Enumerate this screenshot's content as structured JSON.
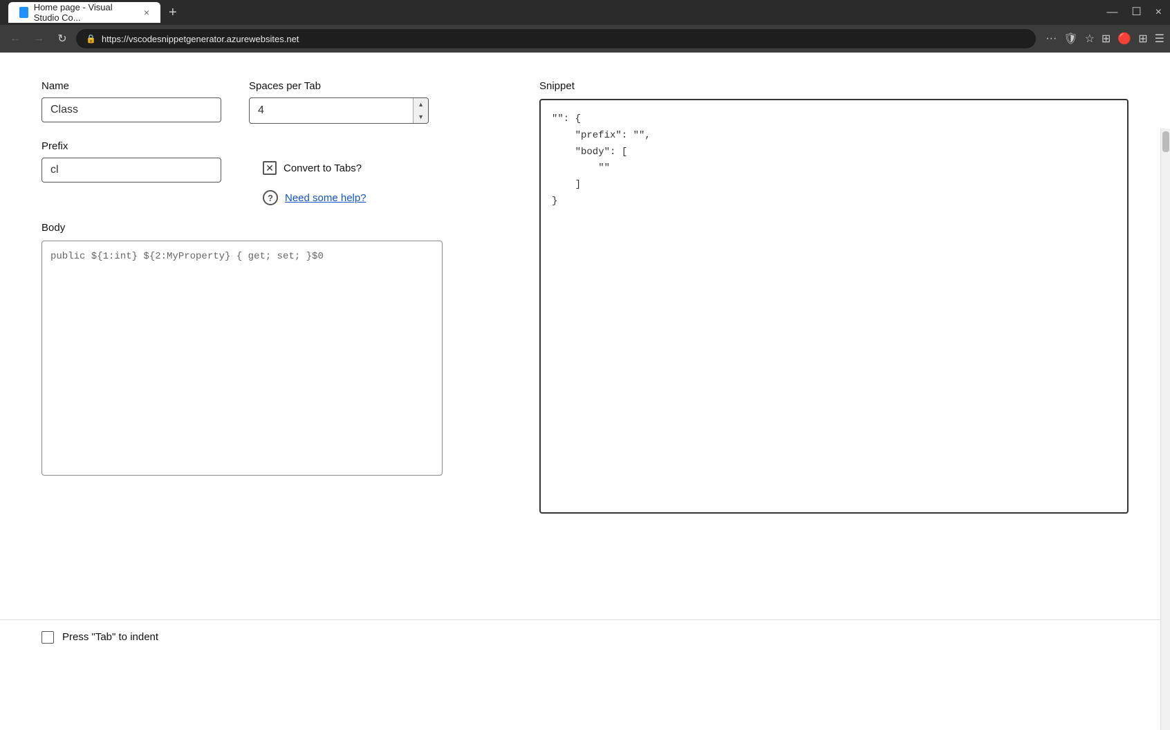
{
  "browser": {
    "tab_title": "Home page - Visual Studio Co...",
    "tab_close": "×",
    "tab_new": "+",
    "url": "https://vscodesnippetgenerator.azurewebsites.net",
    "nav": {
      "back": "←",
      "forward": "→",
      "refresh": "↻"
    },
    "window_controls": {
      "minimize": "—",
      "maximize": "☐",
      "close": "×"
    }
  },
  "form": {
    "name_label": "Name",
    "name_value": "Class",
    "name_placeholder": "",
    "spaces_label": "Spaces per Tab",
    "spaces_value": "4",
    "prefix_label": "Prefix",
    "prefix_value": "cl",
    "prefix_placeholder": "",
    "checkbox_checked": "✕",
    "convert_label": "Convert to Tabs?",
    "help_icon": "?",
    "help_link": "Need some help?",
    "body_label": "Body",
    "body_value": "public ${1:int} ${2:MyProperty} { get; set; }$0",
    "tab_checkbox_label": "Press \"Tab\" to indent"
  },
  "snippet": {
    "label": "Snippet",
    "content": "\"\": {\n    \"prefix\": \"\",\n    \"body\": [\n        \"\"\n    ]\n}"
  }
}
